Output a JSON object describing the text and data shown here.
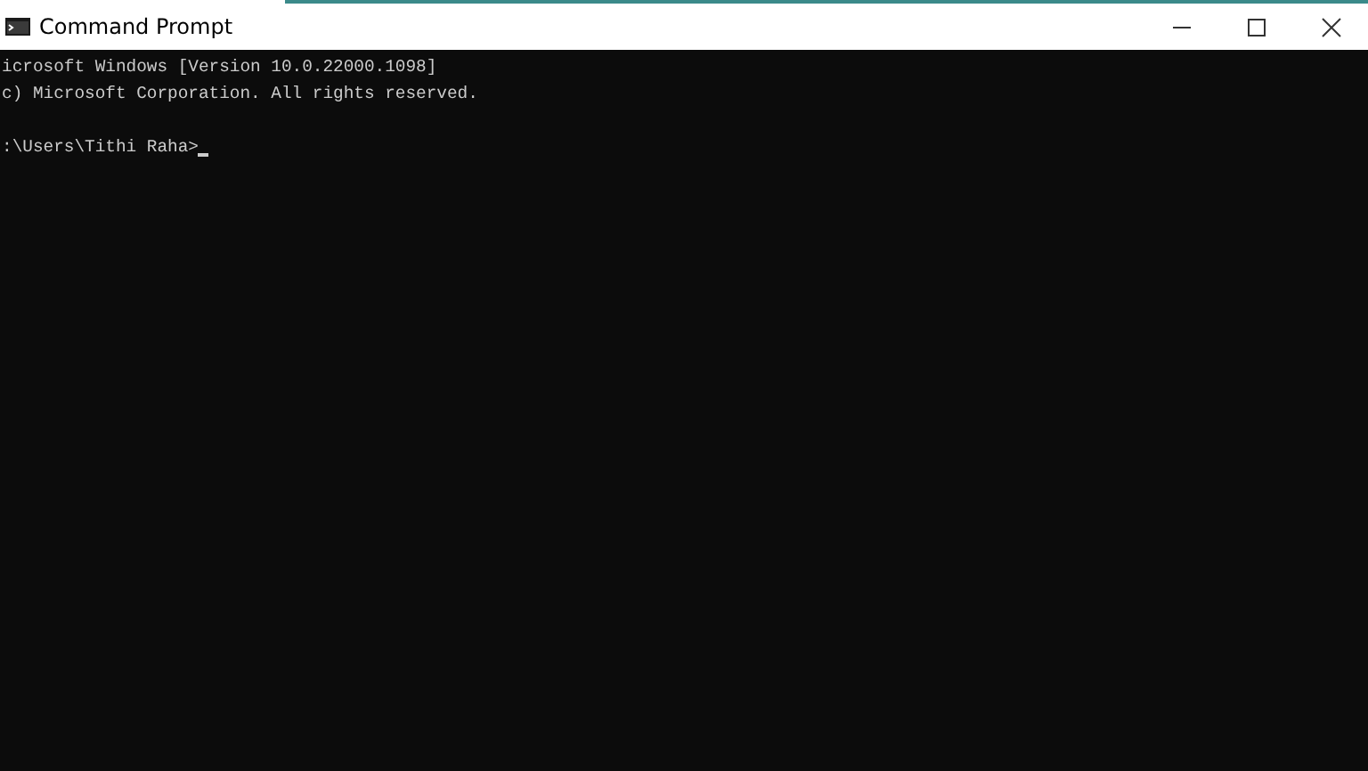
{
  "window": {
    "title": "Command Prompt"
  },
  "console": {
    "lines": [
      {
        "kind": "output",
        "text": "icrosoft Windows [Version 10.0.22000.1098]"
      },
      {
        "kind": "output",
        "text": "c) Microsoft Corporation. All rights reserved."
      },
      {
        "kind": "prompt",
        "text": ":\\Users\\Tithi Raha>"
      }
    ]
  }
}
